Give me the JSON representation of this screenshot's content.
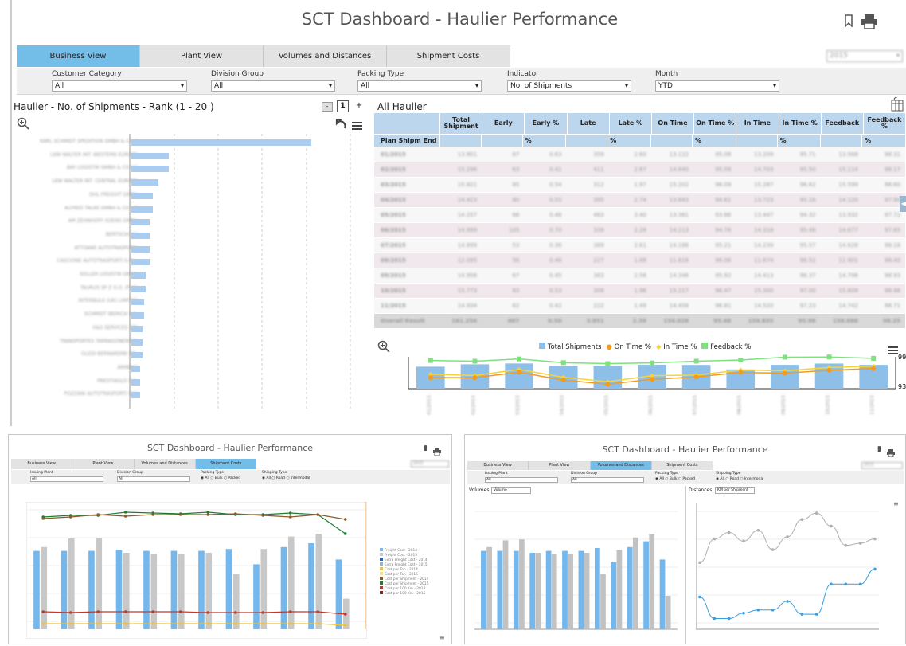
{
  "main": {
    "title": "SCT Dashboard - Haulier Performance",
    "tabs": [
      "Business View",
      "Plant View",
      "Volumes and Distances",
      "Shipment Costs"
    ],
    "active_tab": "Business View",
    "year_select": "2015",
    "filters": [
      {
        "label": "Customer Category",
        "value": "All"
      },
      {
        "label": "Division Group",
        "value": "All"
      },
      {
        "label": "Packing Type",
        "value": "All"
      },
      {
        "label": "Indicator",
        "value": "No. of Shipments"
      },
      {
        "label": "Month",
        "value": "YTD"
      }
    ],
    "left_panel": {
      "title": "Haulier - No. of Shipments - Rank (1 - 20 )",
      "page": "1",
      "minus": "-",
      "plus": "+",
      "hauliers": [
        {
          "name": "KARL SCHMIDT SPEDITION GMBH & CO K",
          "value": 100
        },
        {
          "name": "LKW WALTER INT. WESTERN EUROPE",
          "value": 21
        },
        {
          "name": "BAY LOGISTIK GMBH & CO KG",
          "value": 21
        },
        {
          "name": "LKW WALTER INT. CENTRAL EUROPE",
          "value": 15
        },
        {
          "name": "DHL FREIGHT GMBH",
          "value": 12
        },
        {
          "name": "ALFRED TALKE GMBH & CO KG",
          "value": 12
        },
        {
          "name": "AM ZEHNHOFF-SOENS GMBH",
          "value": 10
        },
        {
          "name": "BERTSCHI AG",
          "value": 10
        },
        {
          "name": "ATTOANE AUTOTRASPORTI",
          "value": 10
        },
        {
          "name": "CASCIONE AUTOTRASPORTI S.R.L.",
          "value": 10
        },
        {
          "name": "SOLLER LOGISTIK GMBH",
          "value": 8
        },
        {
          "name": "TAURUS SP Z O.O. (PLN)",
          "value": 8
        },
        {
          "name": "INTERBULK (UK) LIMITED",
          "value": 7
        },
        {
          "name": "SCHMIDT IBERICA S.A.",
          "value": 7
        },
        {
          "name": "H&S SERVICES LTD",
          "value": 6
        },
        {
          "name": "TRANSPORTES TARRAGONENSES",
          "value": 6
        },
        {
          "name": "OLEDI BERNARDINI SRL",
          "value": 6
        },
        {
          "name": "ARMBAS",
          "value": 5
        },
        {
          "name": "PRESTIAGLO S.A.",
          "value": 5
        },
        {
          "name": "POZZANI AUTOTRASPORTI SAS",
          "value": 5
        }
      ]
    },
    "table": {
      "title": "All Haulier",
      "headers": [
        "Total Shipment",
        "Early",
        "Early %",
        "Late",
        "Late %",
        "On Time",
        "On Time %",
        "In Time",
        "In Time %",
        "Feedback",
        "Feedback %"
      ],
      "row_header": "Plan Shipm End",
      "pct_marker": "%",
      "rows": [
        [
          "01/2015",
          "13.801",
          "87",
          "0.63",
          "359",
          "2.60",
          "13.122",
          "95.08",
          "13.209",
          "95.71",
          "13.568",
          "98.31"
        ],
        [
          "02/2015",
          "15.296",
          "63",
          "0.41",
          "411",
          "2.67",
          "14.640",
          "95.09",
          "14.703",
          "95.50",
          "15.114",
          "98.17"
        ],
        [
          "03/2015",
          "15.821",
          "85",
          "0.54",
          "312",
          "1.97",
          "15.202",
          "96.09",
          "15.287",
          "96.62",
          "15.599",
          "98.60"
        ],
        [
          "04/2015",
          "14.423",
          "80",
          "0.55",
          "395",
          "2.74",
          "13.643",
          "94.61",
          "13.723",
          "95.16",
          "14.120",
          "97.90"
        ],
        [
          "05/2015",
          "14.257",
          "66",
          "0.46",
          "483",
          "3.40",
          "13.381",
          "93.86",
          "13.447",
          "94.32",
          "13.932",
          "97.72"
        ],
        [
          "06/2015",
          "14.999",
          "105",
          "0.70",
          "339",
          "2.26",
          "14.213",
          "94.76",
          "14.318",
          "95.46",
          "14.677",
          "97.85"
        ],
        [
          "07/2015",
          "14.899",
          "53",
          "0.36",
          "389",
          "2.61",
          "14.186",
          "95.21",
          "14.239",
          "95.57",
          "14.628",
          "98.18"
        ],
        [
          "08/2015",
          "12.095",
          "56",
          "0.46",
          "227",
          "1.88",
          "11.618",
          "96.06",
          "11.674",
          "96.52",
          "11.901",
          "98.40"
        ],
        [
          "09/2015",
          "14.956",
          "67",
          "0.45",
          "383",
          "2.56",
          "14.346",
          "95.92",
          "14.413",
          "96.37",
          "14.796",
          "98.93"
        ],
        [
          "10/2015",
          "15.773",
          "83",
          "0.53",
          "309",
          "1.96",
          "15.217",
          "96.47",
          "15.300",
          "97.00",
          "15.609",
          "98.96"
        ],
        [
          "11/2015",
          "14.934",
          "62",
          "0.42",
          "222",
          "1.49",
          "14.458",
          "96.81",
          "14.520",
          "97.23",
          "14.742",
          "98.71"
        ]
      ],
      "total_row": [
        "Overall Result",
        "161.254",
        "807",
        "0.50",
        "3.851",
        "2.39",
        "154.028",
        "95.48",
        "154.835",
        "95.98",
        "158.686",
        "98.25"
      ]
    },
    "combo": {
      "legend": [
        "Total Shipments",
        "On Time %",
        "In Time %",
        "Feedback %"
      ],
      "colors": [
        "#8dbfe8",
        "#f39b1e",
        "#f7d33a",
        "#7ee07e"
      ],
      "y_top": "99",
      "y_bottom": "93",
      "months": [
        "01/2015",
        "02/2015",
        "03/2015",
        "04/2015",
        "05/2015",
        "06/2015",
        "07/2015",
        "08/2015",
        "09/2015",
        "10/2015",
        "11/2015"
      ],
      "total": [
        13801,
        15296,
        15821,
        14423,
        14257,
        14999,
        14899,
        12095,
        14956,
        15773,
        14934
      ],
      "ontime": [
        95.08,
        95.09,
        96.09,
        94.61,
        93.86,
        94.76,
        95.21,
        96.06,
        95.92,
        96.47,
        96.81
      ],
      "intime": [
        95.71,
        95.5,
        96.62,
        95.16,
        94.32,
        95.46,
        95.57,
        96.52,
        96.37,
        97.0,
        97.23
      ],
      "feedback": [
        98.31,
        98.17,
        98.6,
        97.9,
        97.72,
        97.85,
        98.18,
        98.4,
        98.93,
        98.96,
        98.71
      ]
    }
  },
  "thumb_left": {
    "title": "SCT Dashboard - Haulier Performance",
    "tabs": [
      "Business View",
      "Plant View",
      "Volumes and Distances",
      "Shipment Costs"
    ],
    "year": "2015",
    "filters": [
      {
        "label": "Issuing Plant",
        "value": "All"
      },
      {
        "label": "Division Group",
        "value": "All"
      }
    ],
    "packing_label": "Packing Type",
    "packing_opts": [
      "All",
      "Bulk",
      "Packed"
    ],
    "shipping_label": "Shipping Type",
    "shipping_opts": [
      "All",
      "Road",
      "Intermodal"
    ],
    "legend": [
      "Freight Cost - 2014",
      "Freight Cost - 2015",
      "Extra Freight Cost - 2014",
      "Extra Freight Cost - 2015",
      "Cost per Ton - 2014",
      "Cost per Ton - 2015",
      "Cost per Shipment - 2014",
      "Cost per Shipment - 2015",
      "Cost per 100 Km - 2014",
      "Cost per 100 Km - 2015"
    ],
    "legend_colors": [
      "#73b7ec",
      "#c8c8c8",
      "#2a5fb3",
      "#8fb3d9",
      "#f0c23a",
      "#f5e36e",
      "#8b5a2b",
      "#1e7d32",
      "#c0392b",
      "#7b2b2b"
    ],
    "bars2014": [
      82,
      82,
      82,
      83,
      82,
      82,
      82,
      84,
      68,
      86,
      90,
      73
    ],
    "bars2015": [
      86,
      95,
      95,
      80,
      79,
      79,
      80,
      58,
      84,
      97,
      100,
      32
    ]
  },
  "thumb_right": {
    "title": "SCT Dashboard - Haulier Performance",
    "tabs": [
      "Business View",
      "Plant View",
      "Volumes and Distances",
      "Shipment Costs"
    ],
    "year": "2015",
    "filters": [
      {
        "label": "Issuing Plant",
        "value": "All"
      },
      {
        "label": "Division Group",
        "value": "All"
      }
    ],
    "packing_label": "Packing Type",
    "packing_opts": [
      "All",
      "Bulk",
      "Packed"
    ],
    "shipping_label": "Shipping Type",
    "shipping_opts": [
      "All",
      "Road",
      "Intermodal"
    ],
    "volumes_label": "Volumes",
    "volumes_select": "Volume",
    "distances_label": "Distances",
    "distances_select": "KM per Shipment",
    "vol2014": [
      82,
      82,
      82,
      80,
      82,
      82,
      82,
      85,
      70,
      86,
      92,
      73
    ],
    "vol2015": [
      86,
      93,
      94,
      80,
      79,
      79,
      80,
      58,
      83,
      96,
      100,
      35
    ],
    "dist2014": [
      30,
      10,
      10,
      15,
      18,
      18,
      26,
      14,
      14,
      42,
      42,
      42,
      56
    ],
    "dist2015": [
      62,
      84,
      90,
      82,
      92,
      74,
      86,
      102,
      108,
      96,
      78,
      80,
      84
    ]
  }
}
